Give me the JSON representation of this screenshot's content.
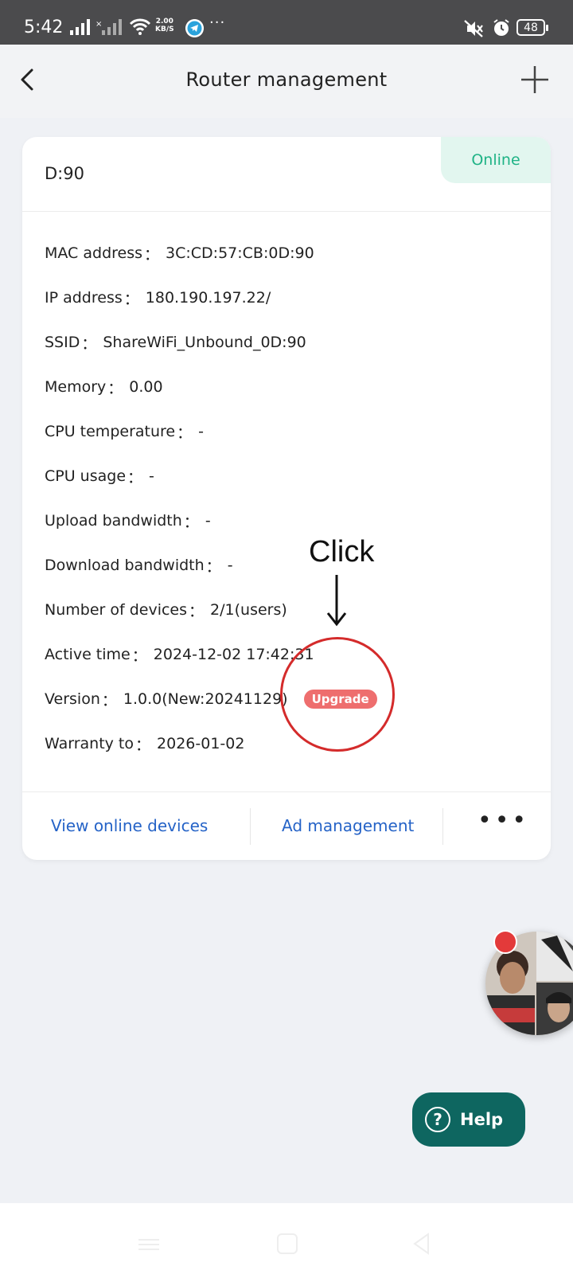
{
  "status_bar": {
    "time": "5:42",
    "net_speed_value": "2.00",
    "net_speed_unit": "KB/S",
    "more": "···",
    "battery": "48",
    "icons": [
      "signal-icon",
      "no-sim-signal-icon",
      "wifi-icon",
      "telegram-icon",
      "mute-icon",
      "alarm-icon",
      "battery-icon"
    ]
  },
  "header": {
    "title": "Router management",
    "back_icon": "chevron-left-icon",
    "add_icon": "plus-icon"
  },
  "card": {
    "device_name": "D:90",
    "status": "Online",
    "info": [
      {
        "label": "MAC address",
        "value": "3C:CD:57:CB:0D:90"
      },
      {
        "label": "IP address",
        "value": "180.190.197.22/"
      },
      {
        "label": "SSID",
        "value": "ShareWiFi_Unbound_0D:90"
      },
      {
        "label": "Memory",
        "value": "0.00"
      },
      {
        "label": "CPU temperature",
        "value": "-"
      },
      {
        "label": "CPU usage",
        "value": "-"
      },
      {
        "label": "Upload bandwidth",
        "value": "-"
      },
      {
        "label": "Download bandwidth",
        "value": "-"
      },
      {
        "label": "Number of devices",
        "value": "2/1(users)"
      },
      {
        "label": "Active time",
        "value": "2024-12-02 17:42:31"
      },
      {
        "label": "Version",
        "value": "1.0.0(New:20241129)"
      },
      {
        "label": "Warranty to",
        "value": "2026-01-02"
      }
    ],
    "colon": "：",
    "upgrade_label": "Upgrade",
    "footer": {
      "view_devices": "View online devices",
      "ad_management": "Ad management",
      "more": "•••"
    }
  },
  "annotation": {
    "text": "Click"
  },
  "help": {
    "label": "Help",
    "icon": "?"
  },
  "colors": {
    "status_bg": "#4b4b4d",
    "online_text": "#1fb386",
    "online_bg": "#e2f6ef",
    "upgrade_bg": "#ee6e6e",
    "link_blue": "#2563c7",
    "help_bg": "#0e6660",
    "circle_red": "#d42b2b"
  }
}
